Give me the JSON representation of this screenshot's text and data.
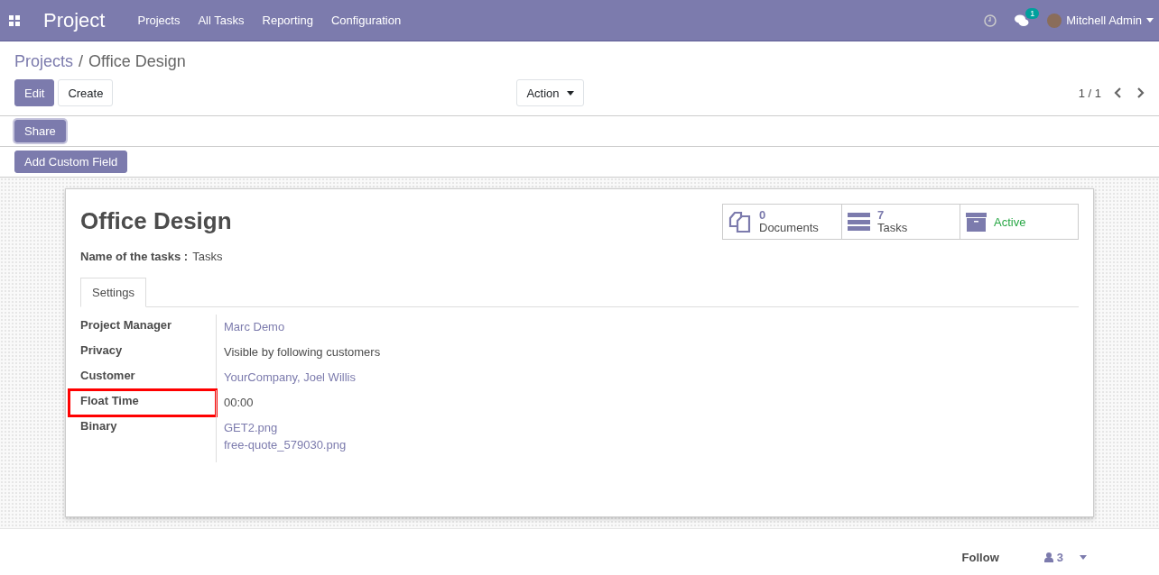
{
  "navbar": {
    "app_name": "Project",
    "menu": [
      "Projects",
      "All Tasks",
      "Reporting",
      "Configuration"
    ],
    "messages_count": "1",
    "user": "Mitchell Admin"
  },
  "breadcrumb": {
    "parent": "Projects",
    "separator": "/",
    "current": "Office Design"
  },
  "buttons": {
    "edit": "Edit",
    "create": "Create",
    "action": "Action",
    "share": "Share",
    "add_custom_field": "Add Custom Field"
  },
  "pager": "1 / 1",
  "sheet": {
    "title": "Office Design",
    "tasks_name_label": "Name of the tasks :",
    "tasks_name_value": "Tasks",
    "smart_buttons": [
      {
        "kind": "documents",
        "count": "0",
        "label": "Documents"
      },
      {
        "kind": "tasks",
        "count": "7",
        "label": "Tasks"
      },
      {
        "kind": "archive",
        "label": "Active"
      }
    ],
    "tabs": [
      {
        "label": "Settings",
        "selected": true
      }
    ],
    "fields": [
      {
        "label": "Project Manager",
        "kind": "link",
        "values": [
          "Marc Demo"
        ],
        "highlighted": false
      },
      {
        "label": "Privacy",
        "kind": "text",
        "values": [
          "Visible by following customers"
        ],
        "highlighted": false
      },
      {
        "label": "Customer",
        "kind": "link",
        "values": [
          "YourCompany, Joel Willis"
        ],
        "highlighted": false
      },
      {
        "label": "Float Time",
        "kind": "text",
        "values": [
          "00:00"
        ],
        "highlighted": true
      },
      {
        "label": "Binary",
        "kind": "link",
        "values": [
          "GET2.png",
          "free-quote_579030.png"
        ],
        "highlighted": false
      }
    ]
  },
  "chatter": {
    "follow": "Follow",
    "followers": "3"
  }
}
